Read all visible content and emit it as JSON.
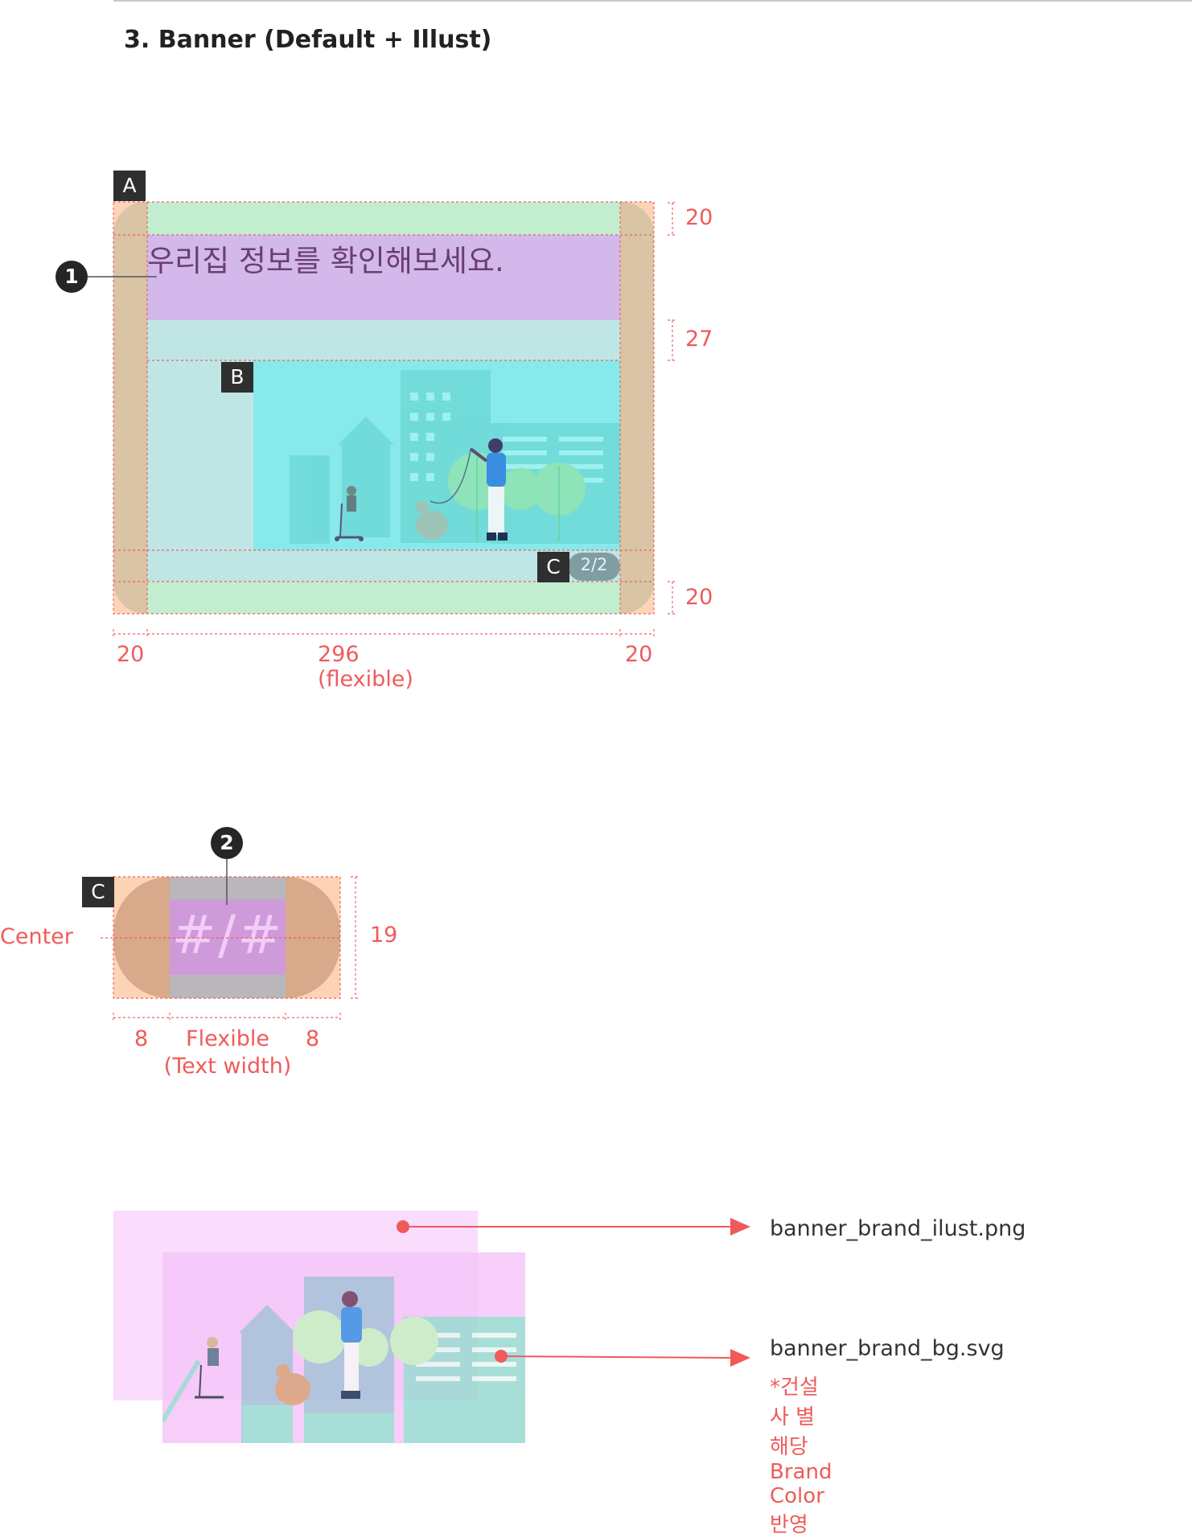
{
  "section_title": "3. Banner (Default + Illust)",
  "banner": {
    "tag_a": "A",
    "tag_b": "B",
    "tag_c": "C",
    "marker_1": "1",
    "title_text": "우리집 정보를 확인해보세요.",
    "indicator": "2/2",
    "dim_top": "20",
    "dim_gap": "27",
    "dim_bottom": "20",
    "dim_left": "20",
    "dim_center": "296 (flexible)",
    "dim_right": "20"
  },
  "indicator_spec": {
    "tag_c": "C",
    "marker_2": "2",
    "placeholder": "#/#",
    "center_label": "Center",
    "height": "19",
    "pad_left": "8",
    "pad_right": "8",
    "flex_line1": "Flexible",
    "flex_line2": "(Text width)"
  },
  "assets": {
    "ilust_file": "banner_brand_ilust.png",
    "bg_file": "banner_brand_bg.svg",
    "bg_note": "*건설사 별 해당 Brand Color 반영"
  },
  "colors": {
    "annotation_red": "#f05a5a",
    "padding_green": "#c2eecf",
    "text_area_purple": "#d3b8ec",
    "side_padding": "#d9c4a5",
    "illust_bg": "#87e9ea",
    "indicator_bg": "#7e9ea2"
  }
}
